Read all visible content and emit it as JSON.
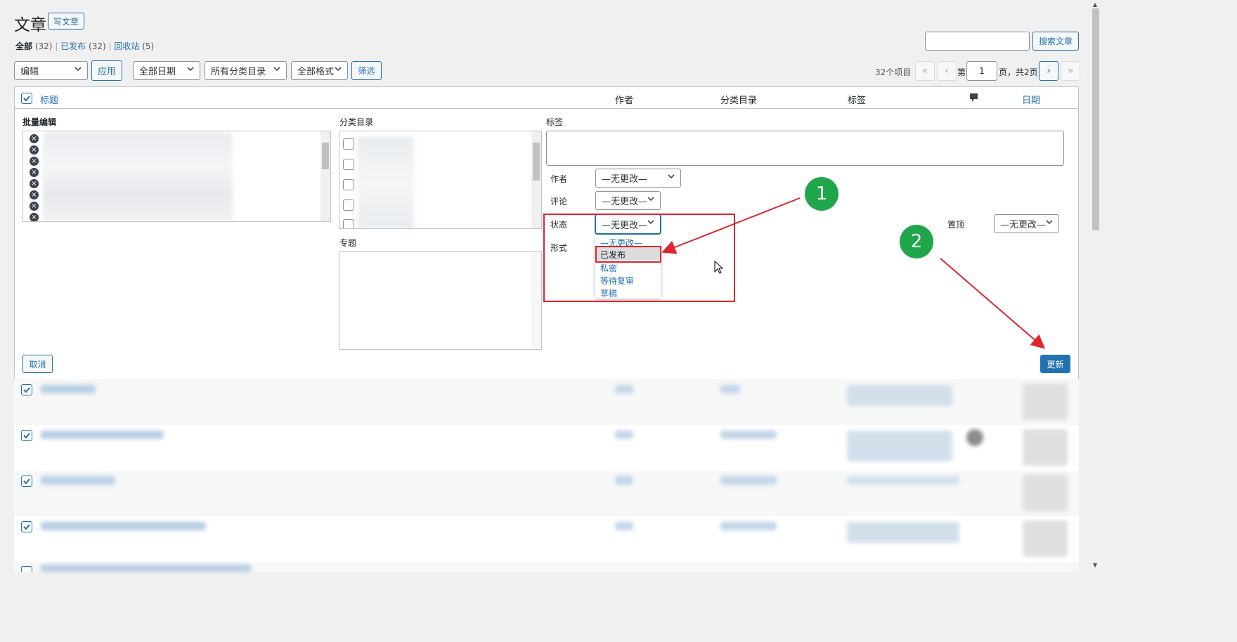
{
  "page": {
    "title": "文章",
    "add_new": "写文章",
    "search_button": "搜索文章",
    "search_value": ""
  },
  "views": [
    {
      "label": "全部",
      "count": "(32)"
    },
    {
      "label": "已发布",
      "count": "(32)"
    },
    {
      "label": "回收站",
      "count": "(5)"
    }
  ],
  "toolbar": {
    "bulk_action": "编辑",
    "apply": "应用",
    "date_filter": "全部日期",
    "category_filter": "所有分类目录",
    "format_filter": "全部格式",
    "filter_button": "筛选"
  },
  "pagination": {
    "items": "32个项目",
    "first": "«",
    "prev": "‹",
    "page_prefix": "第",
    "current": "1",
    "page_suffix": "页，共2页",
    "next": "›",
    "last": "»"
  },
  "table_header": {
    "title": "标题",
    "author": "作者",
    "categories": "分类目录",
    "tags": "标签",
    "date": "日期",
    "comments_icon": "comment-icon"
  },
  "bulk_edit": {
    "heading": "批量编辑",
    "categories_label": "分类目录",
    "topics_label": "专题",
    "tags_label": "标签",
    "tags_value": "",
    "author_label": "作者",
    "author_value": "—无更改—",
    "comments_label": "评论",
    "comments_value": "—无更改—",
    "status_label": "状态",
    "status_value": "—无更改—",
    "format_label": "形式",
    "sticky_label": "置顶",
    "sticky_value": "—无更改—",
    "status_options": [
      "—无更改—",
      "已发布",
      "私密",
      "等待复审",
      "草稿"
    ],
    "status_highlighted": "已发布",
    "cancel": "取消",
    "update": "更新"
  },
  "annotations": {
    "marker_1": "1",
    "marker_2": "2",
    "annotation_color": "#e0242b",
    "marker_color": "#1fa64a"
  },
  "colors": {
    "accent": "#2271b1",
    "background": "#f0f0f1"
  }
}
